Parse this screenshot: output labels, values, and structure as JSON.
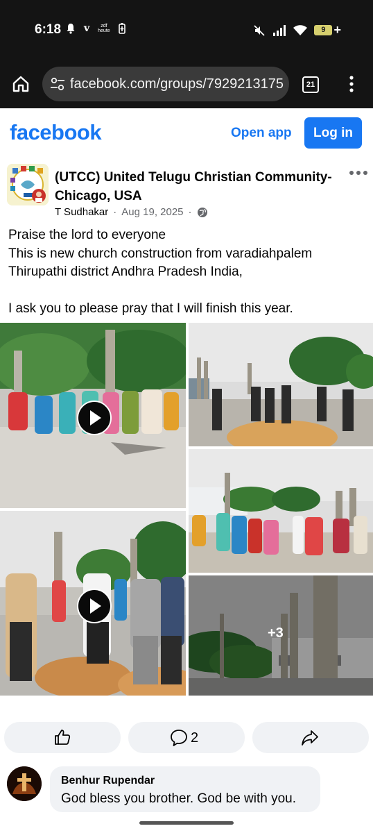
{
  "status_bar": {
    "time": "6:18",
    "carrier_v": "v",
    "zdf_line1": "zdf",
    "zdf_line2": "heute",
    "battery_level": "9",
    "icons": [
      "notification-bell-icon",
      "battery-saver-icon",
      "mute-icon",
      "signal-icon",
      "wifi-icon",
      "battery-icon",
      "charging-plus-icon"
    ]
  },
  "browser": {
    "url": "facebook.com/groups/7929213175",
    "tab_count": "21",
    "icons": [
      "home-icon",
      "site-settings-icon",
      "overflow-menu-icon"
    ]
  },
  "fb_header": {
    "logo": "facebook",
    "open_app_label": "Open app",
    "login_label": "Log in",
    "brand_color": "#1877f2"
  },
  "post": {
    "group_name": "(UTCC) United Telugu Christian Community-Chicago, USA",
    "author": "T Sudhakar",
    "date": "Aug 19, 2025",
    "privacy_icon": "globe-icon",
    "text": "Praise the lord to everyone\nThis is new church construction from varadiahpalem Thirupathi district Andhra Pradesh India,\n\nI ask you to please pray that I will finish this year.",
    "media": {
      "items": [
        "video",
        "photo",
        "video",
        "photo",
        "photo"
      ],
      "more_count": "+3"
    },
    "actions": {
      "like_icon": "thumbs-up-icon",
      "comment_icon": "comment-icon",
      "comment_count": "2",
      "share_icon": "share-icon"
    }
  },
  "comment": {
    "author": "Benhur Rupendar",
    "text": "God bless you brother. God be with you."
  }
}
